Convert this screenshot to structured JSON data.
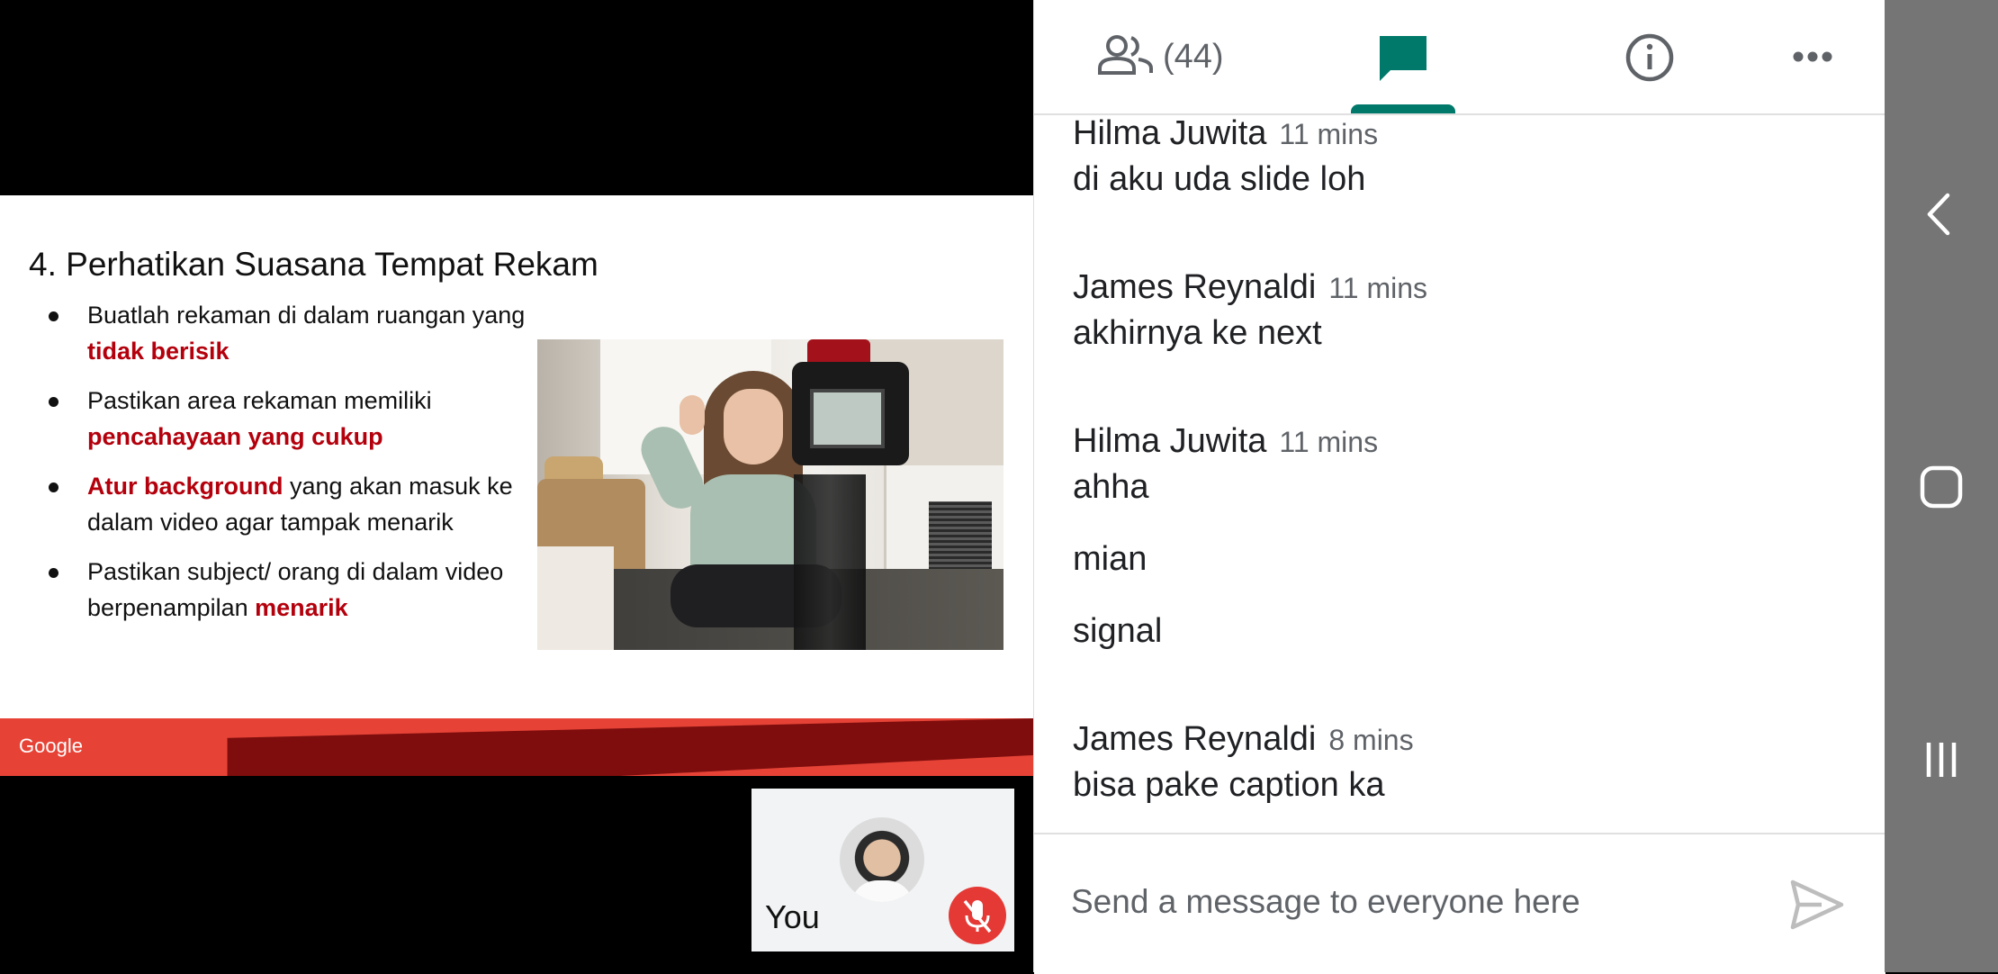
{
  "slide": {
    "title": "4. Perhatikan Suasana Tempat Rekam",
    "bullets": [
      {
        "parts": [
          {
            "text": "Buatlah rekaman di dalam ruangan yang "
          },
          {
            "text": "tidak berisik",
            "hl": true
          }
        ]
      },
      {
        "parts": [
          {
            "text": "Pastikan area rekaman memiliki "
          },
          {
            "text": "pencahayaan yang cukup",
            "hl": true
          }
        ]
      },
      {
        "parts": [
          {
            "text": "Atur background",
            "hl": true
          },
          {
            "text": " yang akan masuk ke dalam video agar tampak menarik"
          }
        ]
      },
      {
        "parts": [
          {
            "text": "Pastikan subject/ orang di dalam video berpenampilan "
          },
          {
            "text": "menarik",
            "hl": true
          }
        ]
      }
    ],
    "footer_logo": "Google",
    "highlight_color": "#b3000c"
  },
  "self_view": {
    "label": "You"
  },
  "tabs": {
    "people_count": "(44)"
  },
  "messages": [
    {
      "sender": "Hilma Juwita",
      "time": "11 mins",
      "texts": [
        "di aku uda slide loh"
      ]
    },
    {
      "sender": "James Reynaldi",
      "time": "11 mins",
      "texts": [
        "akhirnya ke next"
      ]
    },
    {
      "sender": "Hilma Juwita",
      "time": "11 mins",
      "texts": [
        "ahha",
        "mian",
        "signal"
      ]
    },
    {
      "sender": "James Reynaldi",
      "time": "8 mins",
      "texts": [
        "bisa pake caption ka"
      ]
    }
  ],
  "composer": {
    "placeholder": "Send a message to everyone here"
  },
  "colors": {
    "accent": "#00796b",
    "mic_off": "#e53935",
    "footer_red": "#e64336",
    "footer_dark": "#7f0d0d"
  }
}
